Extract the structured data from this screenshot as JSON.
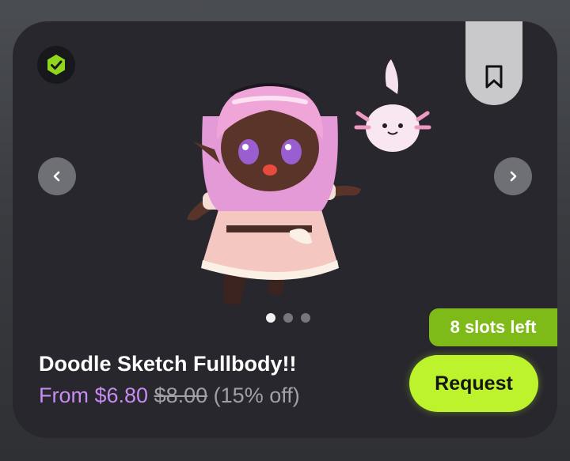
{
  "listing": {
    "title": "Doodle Sketch Fullbody!!",
    "price_from": "From $6.80",
    "price_original": "$8.00",
    "discount": "(15% off)",
    "slots_left": "8 slots left",
    "request_label": "Request"
  },
  "carousel": {
    "slide_count": 3,
    "active_index": 0
  },
  "icons": {
    "verified": "verified-shield-icon",
    "bookmark": "bookmark-icon",
    "prev": "chevron-left-icon",
    "next": "chevron-right-icon"
  },
  "colors": {
    "accent": "#bdf32c",
    "badge": "#7fbb18",
    "price": "#c68cf0",
    "card_bg": "#27272d"
  }
}
